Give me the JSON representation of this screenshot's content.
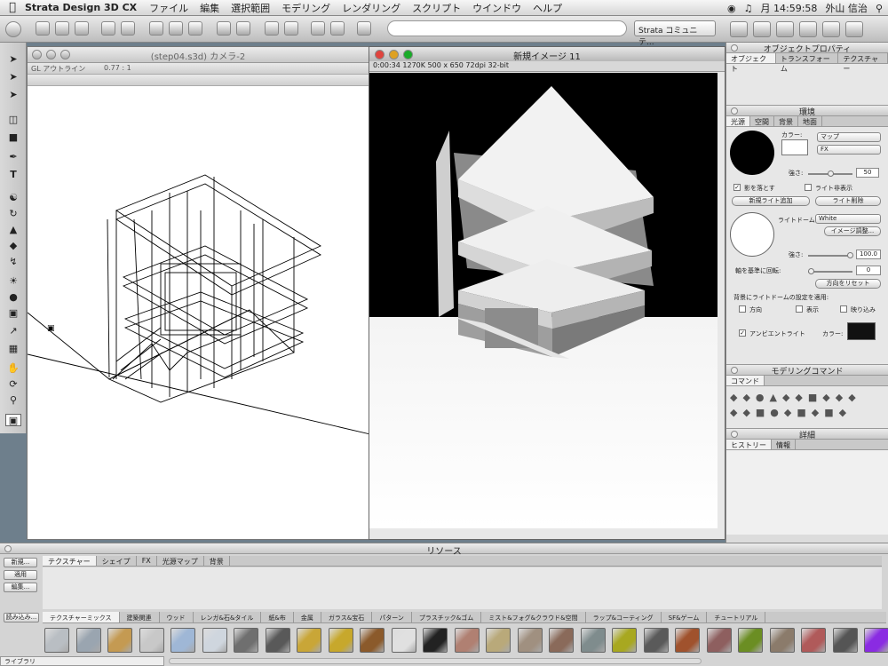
{
  "menubar": {
    "app": "Strata Design 3D CX",
    "items": [
      "ファイル",
      "編集",
      "選択範囲",
      "モデリング",
      "レンダリング",
      "スクリプト",
      "ウインドウ",
      "ヘルプ"
    ],
    "clock": "月 14:59:58",
    "user": "外山 信治"
  },
  "toolbar": {
    "community": "Strata コミュニテ..."
  },
  "model_window": {
    "title": "(step04.s3d) カメラ-2",
    "view": "GL アウトライン",
    "zoom": "0.77 : 1"
  },
  "render_window": {
    "title": "新規イメージ 11",
    "info": "0:00:34   1270K   500 x 650   72dpi   32-bit"
  },
  "properties": {
    "title": "オブジェクトプロパティ",
    "tabs": [
      "オブジェクト",
      "トランスフォーム",
      "テクスチャー"
    ]
  },
  "environment": {
    "title": "環境",
    "tabs": [
      "光源",
      "空間",
      "背景",
      "地面"
    ],
    "color_label": "カラー:",
    "map_select": "マップ",
    "fx_select": "FX",
    "intensity_label": "強さ:",
    "intensity_value": "50",
    "cast_shadow": "影を落とす",
    "hide_light": "ライト非表示",
    "add_light": "新規ライト追加",
    "delete_light": "ライト削除",
    "dome_label": "ライトドーム:",
    "dome_value": "White",
    "image_adjust": "イメージ調整...",
    "dome_intensity_label": "強さ:",
    "dome_intensity_value": "100.0",
    "rotate_label": "軸を基準に回転:",
    "rotate_value": "0",
    "reset_dir": "方向をリセット",
    "apply_label": "背景にライトドームの設定を適用:",
    "opt_direction": "方向",
    "opt_display": "表示",
    "opt_reflect": "映り込み",
    "ambient": "アンビエントライト",
    "ambient_color_label": "カラー:"
  },
  "modeling": {
    "title": "モデリングコマンド",
    "tab": "コマンド"
  },
  "details": {
    "title": "詳細",
    "tabs": [
      "ヒストリー",
      "情報"
    ]
  },
  "resources": {
    "title": "リソース",
    "buttons": [
      "新規...",
      "適用",
      "編集..."
    ],
    "tabs": [
      "テクスチャー",
      "シェイプ",
      "FX",
      "光源マップ",
      "背景"
    ],
    "load": "読み込み...",
    "categories": [
      "テクスチャーミックス",
      "建築関連",
      "ウッド",
      "レンガ&石&タイル",
      "紙&布",
      "金属",
      "ガラス&宝石",
      "パターン",
      "プラスチック&ゴム",
      "ミスト&フォグ&クラウド&空間",
      "ラップ&コーティング",
      "SF&ゲーム",
      "チュートリアル"
    ],
    "library": "ライブラリ"
  },
  "swatch_colors": [
    "#b9bec3",
    "#9aa5b0",
    "#c49a52",
    "#c8c8c8",
    "#9fb7d6",
    "#cfd6de",
    "#6f6f6f",
    "#595959",
    "#c9a637",
    "#c7a82c",
    "#8b5a2b",
    "#e0e0e0",
    "#222222",
    "#b08072",
    "#b9a97a",
    "#a09080",
    "#8a6a5a",
    "#7f8c8d",
    "#a8a820",
    "#5a5a5a",
    "#a0522d",
    "#8e5f5f",
    "#6b8e23",
    "#8b7b6b",
    "#b05a5a",
    "#555555",
    "#8a2be2"
  ]
}
